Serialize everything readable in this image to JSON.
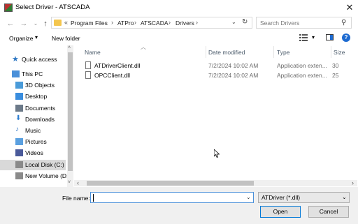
{
  "window": {
    "title": "Select Driver - ATSCADA",
    "close_glyph": "✕"
  },
  "nav_buttons": {
    "back": "←",
    "forward": "→",
    "recent": "⌄",
    "up": "↑"
  },
  "address": {
    "overflow": "«",
    "separator": "›",
    "crumbs": [
      "Program Files",
      "ATPro",
      "ATSCADA",
      "Drivers"
    ],
    "dropdown_glyph": "⌄",
    "refresh_glyph": "↻"
  },
  "search": {
    "placeholder": "Search Drivers",
    "icon_glyph": "⚲"
  },
  "toolbar": {
    "organize_label": "Organize",
    "organize_caret": "▾",
    "new_folder_label": "New folder",
    "view_caret": "▾",
    "help_glyph": "?"
  },
  "sidebar": {
    "items": [
      {
        "label": "Quick access",
        "icon": "star-icon",
        "color": "#2f78c4"
      },
      {
        "label": "This PC",
        "icon": "computer-icon",
        "color": "#4a90d9"
      },
      {
        "label": "3D Objects",
        "icon": "cube-icon",
        "color": "#4a9bd9"
      },
      {
        "label": "Desktop",
        "icon": "desktop-icon",
        "color": "#3a8dde"
      },
      {
        "label": "Documents",
        "icon": "documents-icon",
        "color": "#6c7a89"
      },
      {
        "label": "Downloads",
        "icon": "download-icon",
        "color": "#2f7fd1"
      },
      {
        "label": "Music",
        "icon": "music-icon",
        "color": "#3478c6"
      },
      {
        "label": "Pictures",
        "icon": "pictures-icon",
        "color": "#5aa0e0"
      },
      {
        "label": "Videos",
        "icon": "videos-icon",
        "color": "#4a5a9a"
      },
      {
        "label": "Local Disk (C:)",
        "icon": "drive-icon",
        "color": "#8a8a8a"
      },
      {
        "label": "New Volume (D:",
        "icon": "drive-icon",
        "color": "#8a8a8a"
      }
    ],
    "selected_index": 9
  },
  "columns": [
    "Name",
    "Date modified",
    "Type",
    "Size"
  ],
  "files": [
    {
      "name": "ATDriverClient.dll",
      "date": "7/2/2024 10:02 AM",
      "type": "Application exten...",
      "size": "30"
    },
    {
      "name": "OPCClient.dll",
      "date": "7/2/2024 10:02 AM",
      "type": "Application exten...",
      "size": "25"
    }
  ],
  "scroll": {
    "left": "‹",
    "right": "›",
    "up": "˄",
    "down": "˅"
  },
  "footer": {
    "file_name_label": "File name:",
    "file_name_value": "",
    "file_name_caret": "⌄",
    "filter_value": "ATDriver (*.dll)",
    "filter_caret": "⌄",
    "open_label": "Open",
    "cancel_label": "Cancel"
  },
  "colors": {
    "accent": "#0078d7",
    "selection": "#cce8ff",
    "folder": "#f4c64e"
  }
}
